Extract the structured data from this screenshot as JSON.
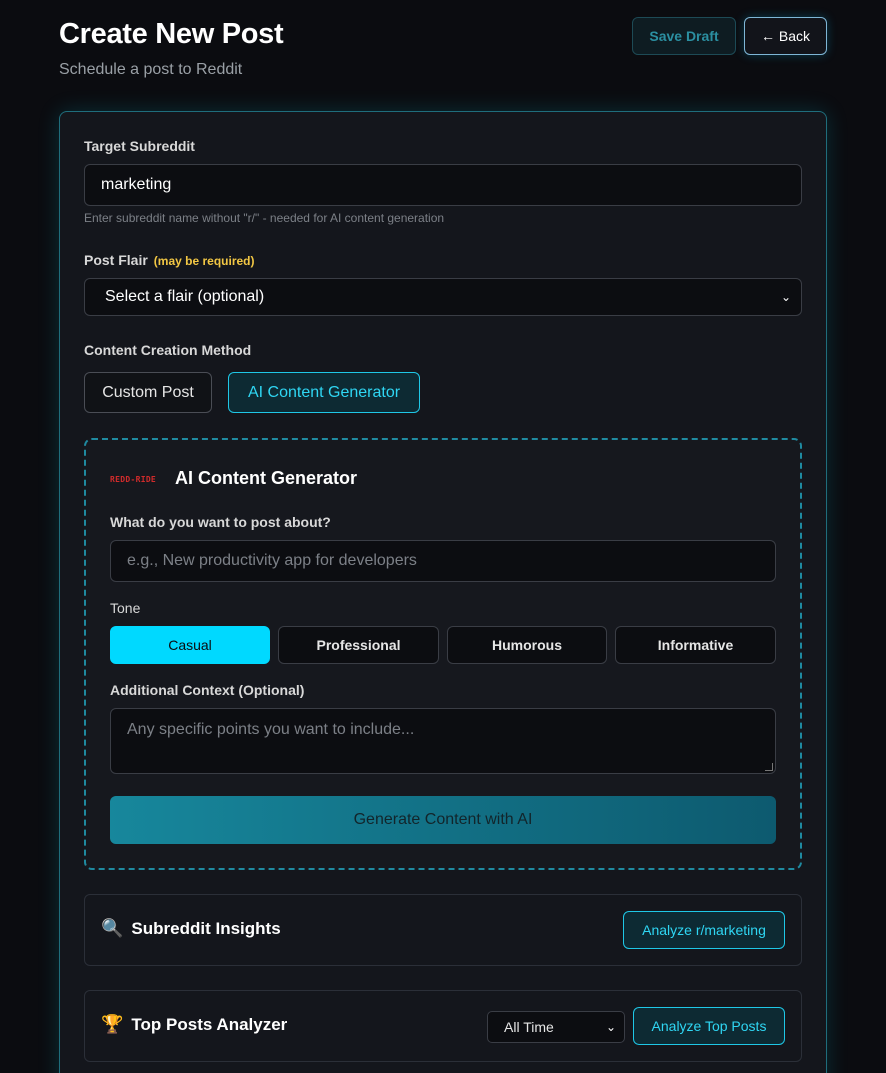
{
  "header": {
    "title": "Create New Post",
    "subtitle": "Schedule a post to Reddit",
    "save_draft_label": "Save Draft",
    "back_label": "← Back"
  },
  "subreddit": {
    "label": "Target Subreddit",
    "value": "marketing",
    "help": "Enter subreddit name without \"r/\" - needed for AI content generation"
  },
  "flair": {
    "label": "Post Flair",
    "note": "(may be required)",
    "selected": "Select a flair (optional)"
  },
  "method": {
    "label": "Content Creation Method",
    "custom_label": "Custom Post",
    "ai_label": "AI Content Generator",
    "active": "ai"
  },
  "ai_generator": {
    "logo_text": "REDD-RIDE",
    "title": "AI Content Generator",
    "topic_label": "What do you want to post about?",
    "topic_placeholder": "e.g., New productivity app for developers",
    "tone_label": "Tone",
    "tones": [
      "Casual",
      "Professional",
      "Humorous",
      "Informative"
    ],
    "active_tone": "Casual",
    "context_label": "Additional Context (Optional)",
    "context_placeholder": "Any specific points you want to include...",
    "generate_label": "Generate Content with AI"
  },
  "insights": {
    "icon": "magnifier-icon",
    "title": "Subreddit Insights",
    "button_label": "Analyze r/marketing"
  },
  "top_posts": {
    "icon": "trophy-icon",
    "title": "Top Posts Analyzer",
    "time_selected": "All Time",
    "button_label": "Analyze Top Posts"
  },
  "colors": {
    "accent": "#00d9ff",
    "background": "#0b0c10",
    "warning": "#f2c744"
  }
}
